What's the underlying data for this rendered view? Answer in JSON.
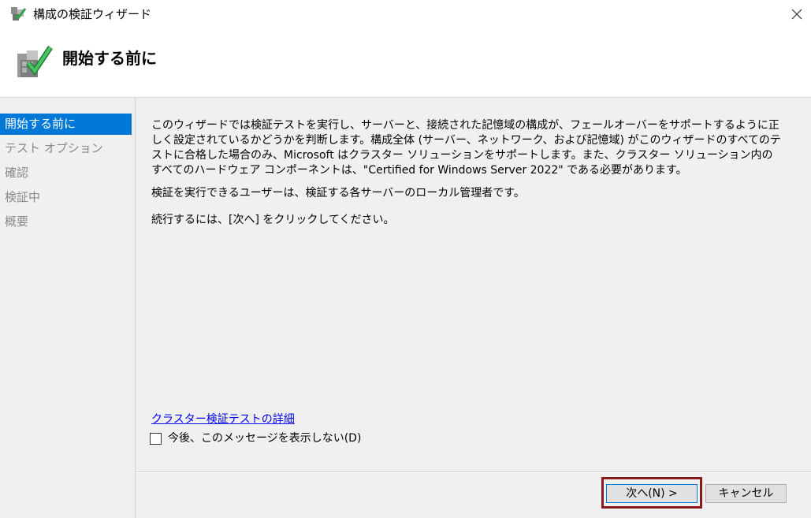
{
  "window": {
    "title": "構成の検証ウィザード",
    "close_icon": "close-icon"
  },
  "header": {
    "title": "開始する前に",
    "icon": "validate-checkmark-icon"
  },
  "nav": {
    "items": [
      {
        "label": "開始する前に",
        "active": true
      },
      {
        "label": "テスト オプション",
        "active": false
      },
      {
        "label": "確認",
        "active": false
      },
      {
        "label": "検証中",
        "active": false
      },
      {
        "label": "概要",
        "active": false
      }
    ]
  },
  "content": {
    "paragraphs": [
      "このウィザードでは検証テストを実行し、サーバーと、接続された記憶域の構成が、フェールオーバーをサポートするように正しく設定されているかどうかを判断します。構成全体 (サーバー、ネットワーク、および記憶域) がこのウィザードのすべてのテストに合格した場合のみ、Microsoft はクラスター ソリューションをサポートします。また、クラスター ソリューション内のすべてのハードウェア コンポーネントは、\"Certified for Windows Server 2022\" である必要があります。",
      "検証を実行できるユーザーは、検証する各サーバーのローカル管理者です。",
      "続行するには、[次へ] をクリックしてください。"
    ],
    "link": "クラスター検証テストの詳細",
    "checkbox_label": "今後、このメッセージを表示しない(D)",
    "checkbox_checked": false
  },
  "buttons": {
    "next": "次へ(N) >",
    "cancel": "キャンセル"
  },
  "colors": {
    "accent": "#0078d7",
    "highlight_border": "#8b1a1a",
    "link": "#0000ee"
  }
}
